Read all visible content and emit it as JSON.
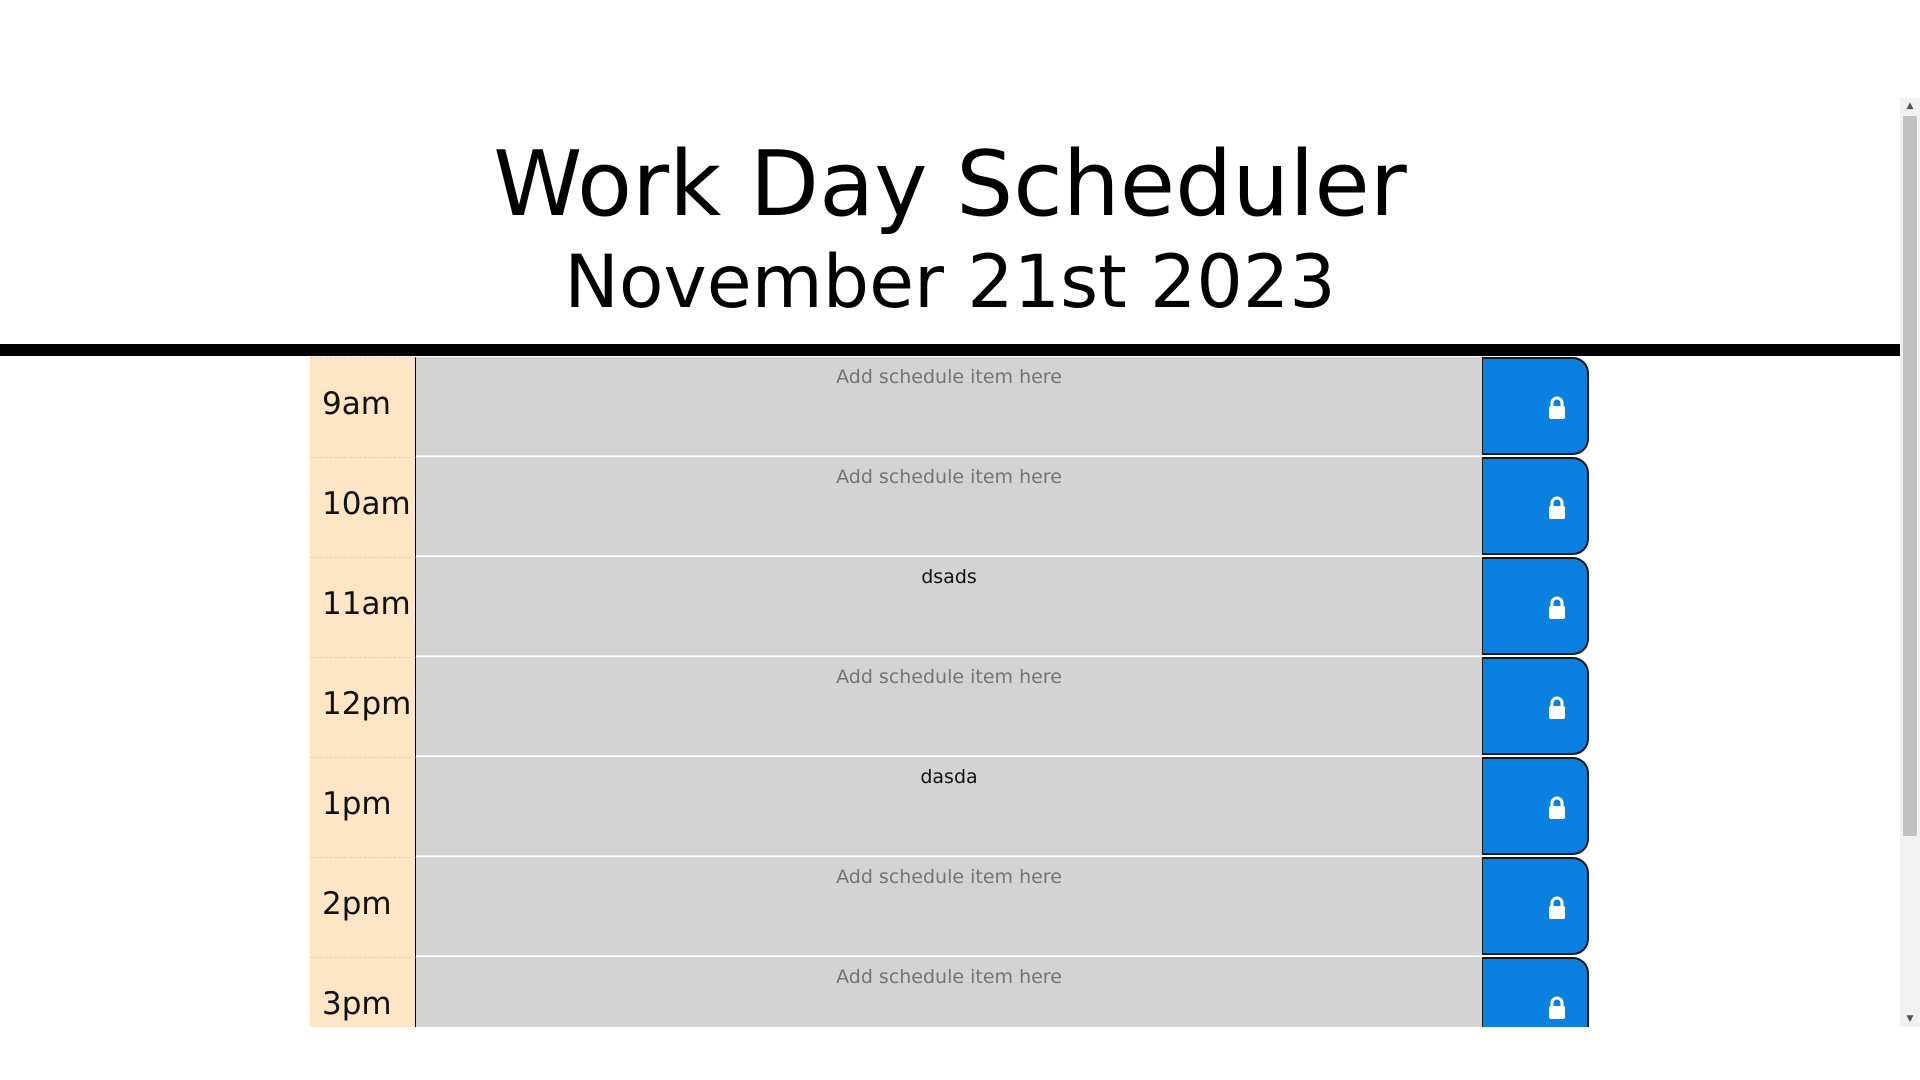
{
  "header": {
    "title": "Work Day Scheduler",
    "date": "November 21st 2023"
  },
  "colors": {
    "hour_background": "#fde5c5",
    "entry_background": "#d3d3d3",
    "save_button": "#0a80e0"
  },
  "schedule": {
    "placeholder": "Add schedule item here",
    "save_icon": "lock-icon",
    "rows": [
      {
        "hour": "9am",
        "value": ""
      },
      {
        "hour": "10am",
        "value": ""
      },
      {
        "hour": "11am",
        "value": "dsads"
      },
      {
        "hour": "12pm",
        "value": ""
      },
      {
        "hour": "1pm",
        "value": "dasda"
      },
      {
        "hour": "2pm",
        "value": ""
      },
      {
        "hour": "3pm",
        "value": ""
      }
    ]
  },
  "scrollbar": {
    "up_arrow": "▲",
    "down_arrow": "▼"
  }
}
